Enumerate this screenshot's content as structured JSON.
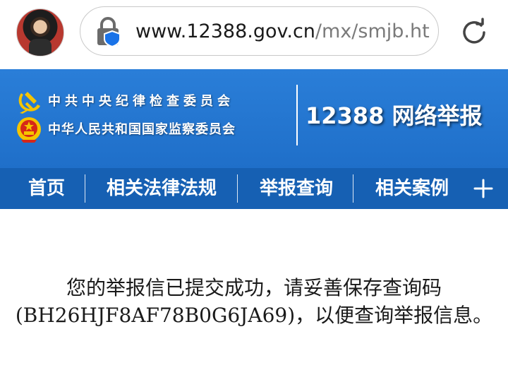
{
  "browser": {
    "url_domain": "www.12388.gov.cn",
    "url_path": "/mx/smjb.htr",
    "icons": {
      "lock": "lock-shield-icon",
      "reload": "reload-icon"
    }
  },
  "header": {
    "org_line_1": "中共中央纪律检查委员会",
    "org_line_2": "中华人民共和国国家监察委员会",
    "site_title": "12388 网络举报",
    "colors": {
      "header_bg": "#2477d4",
      "nav_bg": "#1660b3"
    }
  },
  "nav": {
    "items": [
      "首页",
      "相关法律法规",
      "举报查询",
      "相关案例"
    ],
    "more_icon": "plus-icon"
  },
  "message": {
    "text": "您的举报信已提交成功，请妥善保存查询码(BH26HJF8AF78B0G6JA69)，以便查询举报信息。"
  }
}
